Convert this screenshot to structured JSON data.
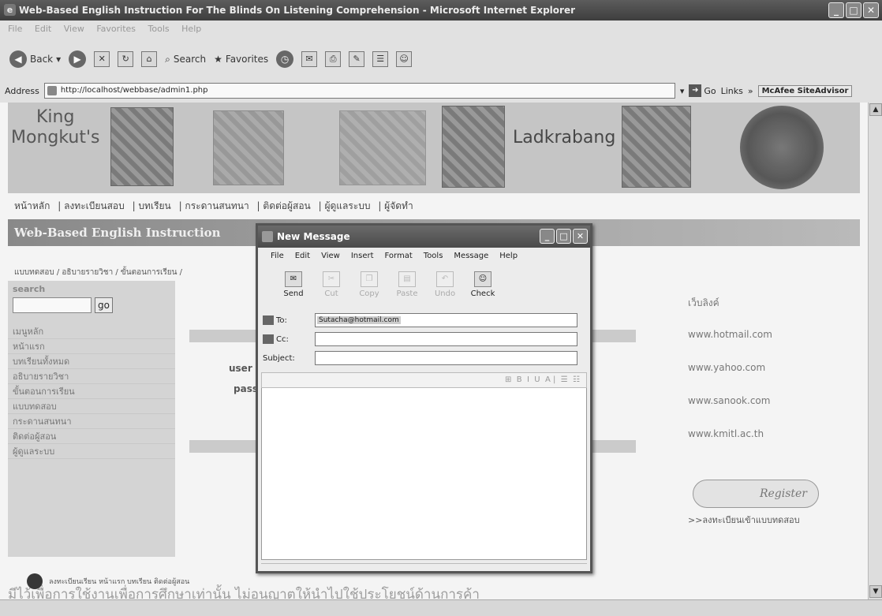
{
  "window": {
    "title": "Web-Based English Instruction For The Blinds On Listening Comprehension - Microsoft Internet Explorer",
    "menu": [
      "File",
      "Edit",
      "View",
      "Favorites",
      "Tools",
      "Help"
    ]
  },
  "toolbar": {
    "back_label": "Back",
    "search_label": "Search",
    "favorites_label": "Favorites"
  },
  "address": {
    "label": "Address",
    "url": "http://localhost/webbase/admin1.php",
    "go_label": "Go",
    "links_label": "Links",
    "mcafee_label": "McAfee SiteAdvisor"
  },
  "banner": {
    "text_left1": "King",
    "text_left2": "Mongkut's",
    "text_right": "Ladkrabang"
  },
  "nav": {
    "items": [
      "หน้าหลัก",
      "| ลงทะเบียนสอบ",
      "| บทเรียน",
      "| กระดานสนทนา",
      "| ติดต่อผู้สอน",
      "| ผู้ดูแลระบบ",
      "| ผู้จัดทำ"
    ]
  },
  "site_title": "Web-Based English Instruction",
  "breadcrumb": "แบบทดสอบ / อธิบายรายวิชา / ขั้นตอนการเรียน / ",
  "sidebar": {
    "search_label": "search",
    "go_label": "go",
    "menu_label": "เมนูหลัก",
    "items": [
      "หน้าแรก",
      "บทเรียนทั้งหมด",
      "อธิบายรายวิชา",
      "ขั้นตอนการเรียน",
      "แบบทดสอบ",
      "กระดานสนทนา",
      "ติดต่อผู้สอน",
      "ผู้ดูแลระบบ"
    ]
  },
  "login": {
    "user_label": "user",
    "pass_label": "pass"
  },
  "links": {
    "heading": "เว็บลิงค์",
    "items": [
      "www.hotmail.com",
      "www.yahoo.com",
      "www.sanook.com",
      "www.kmitl.ac.th"
    ]
  },
  "register": {
    "button_label": "Register",
    "link_text": ">>ลงทะเบียนเข้าแบบทดสอบ"
  },
  "footer": {
    "text": "ลงทะเบียนเรียน หน้าแรก บทเรียน ติดต่อผู้สอน"
  },
  "dialog": {
    "title": "New Message",
    "menu": [
      "File",
      "Edit",
      "View",
      "Insert",
      "Format",
      "Tools",
      "Message",
      "Help"
    ],
    "tools": [
      {
        "label": "Send",
        "enabled": true
      },
      {
        "label": "Cut",
        "enabled": false
      },
      {
        "label": "Copy",
        "enabled": false
      },
      {
        "label": "Paste",
        "enabled": false
      },
      {
        "label": "Undo",
        "enabled": false
      },
      {
        "label": "Check",
        "enabled": true
      }
    ],
    "to_label": "To:",
    "to_value": "Sutacha@hotmail.com",
    "cc_label": "Cc:",
    "cc_value": "",
    "subject_label": "Subject:",
    "subject_value": "",
    "body_value": ""
  },
  "watermark": "มีไว้เพื่อการใช้งานเพื่อการศึกษาเท่านั้น ไม่อนุญาตให้นำไปใช้ประโยชน์ด้านการค้า"
}
